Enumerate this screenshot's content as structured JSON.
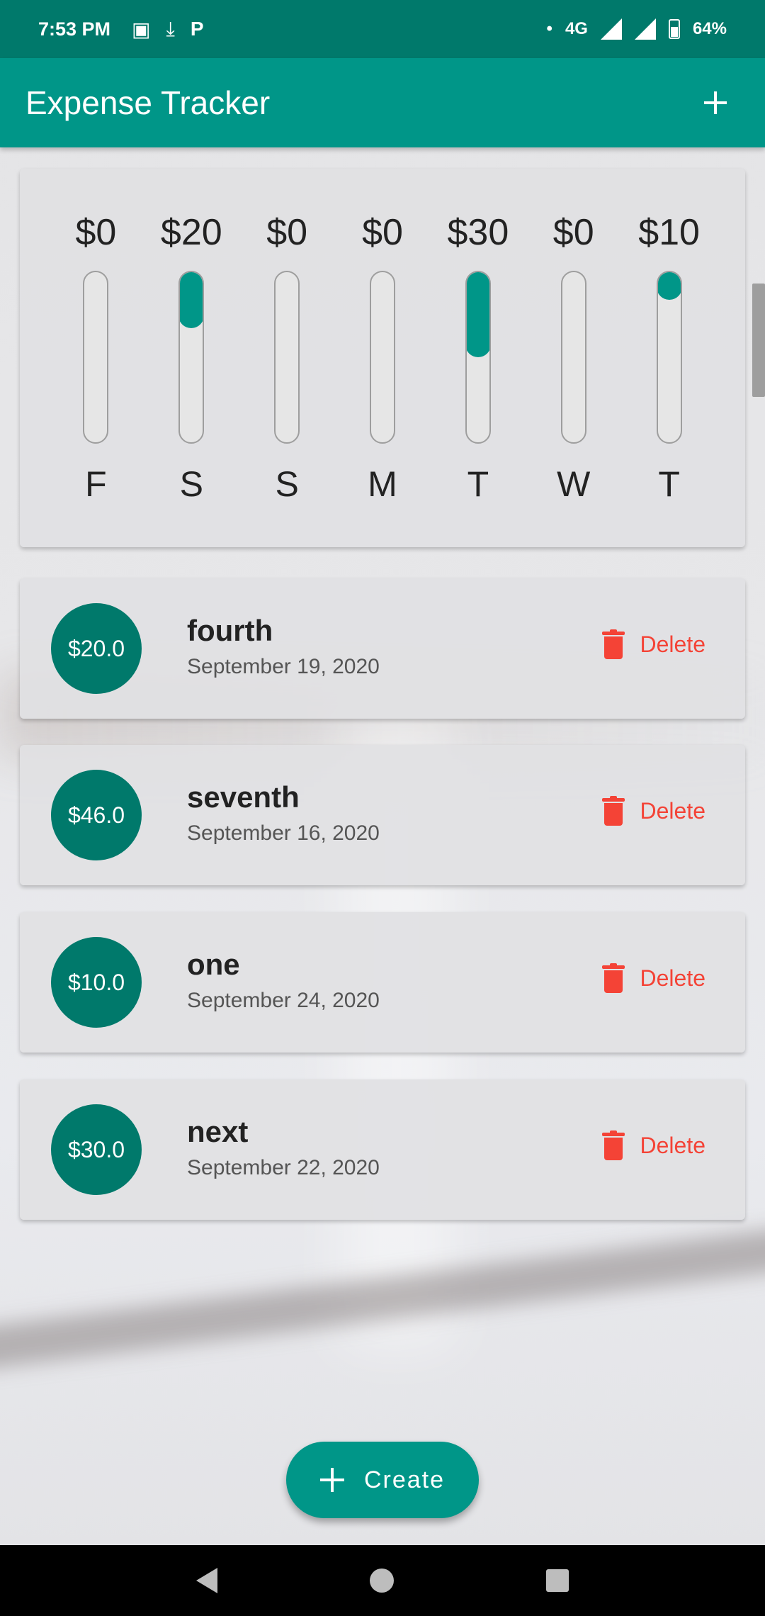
{
  "status_bar": {
    "time": "7:53 PM",
    "icons_left": [
      "image-icon",
      "download-icon",
      "p-icon"
    ],
    "network": "4G",
    "battery": "64%"
  },
  "app_bar": {
    "title": "Expense Tracker",
    "add_icon": "plus-icon"
  },
  "chart": {
    "days": [
      {
        "amount": "$0",
        "day": "F",
        "fill": 0
      },
      {
        "amount": "$20",
        "day": "S",
        "fill": 0.33
      },
      {
        "amount": "$0",
        "day": "S",
        "fill": 0
      },
      {
        "amount": "$0",
        "day": "M",
        "fill": 0
      },
      {
        "amount": "$30",
        "day": "T",
        "fill": 0.5
      },
      {
        "amount": "$0",
        "day": "W",
        "fill": 0
      },
      {
        "amount": "$10",
        "day": "T",
        "fill": 0.17
      }
    ]
  },
  "transactions": [
    {
      "amount": "$20.0",
      "title": "fourth",
      "date": "September 19, 2020",
      "delete_label": "Delete"
    },
    {
      "amount": "$46.0",
      "title": "seventh",
      "date": "September 16, 2020",
      "delete_label": "Delete"
    },
    {
      "amount": "$10.0",
      "title": "one",
      "date": "September 24, 2020",
      "delete_label": "Delete"
    },
    {
      "amount": "$30.0",
      "title": "next",
      "date": "September 22, 2020",
      "delete_label": "Delete"
    }
  ],
  "fab": {
    "label": "Create"
  },
  "colors": {
    "primary": "#009688",
    "primary_dark": "#00796b",
    "delete": "#f44336"
  }
}
